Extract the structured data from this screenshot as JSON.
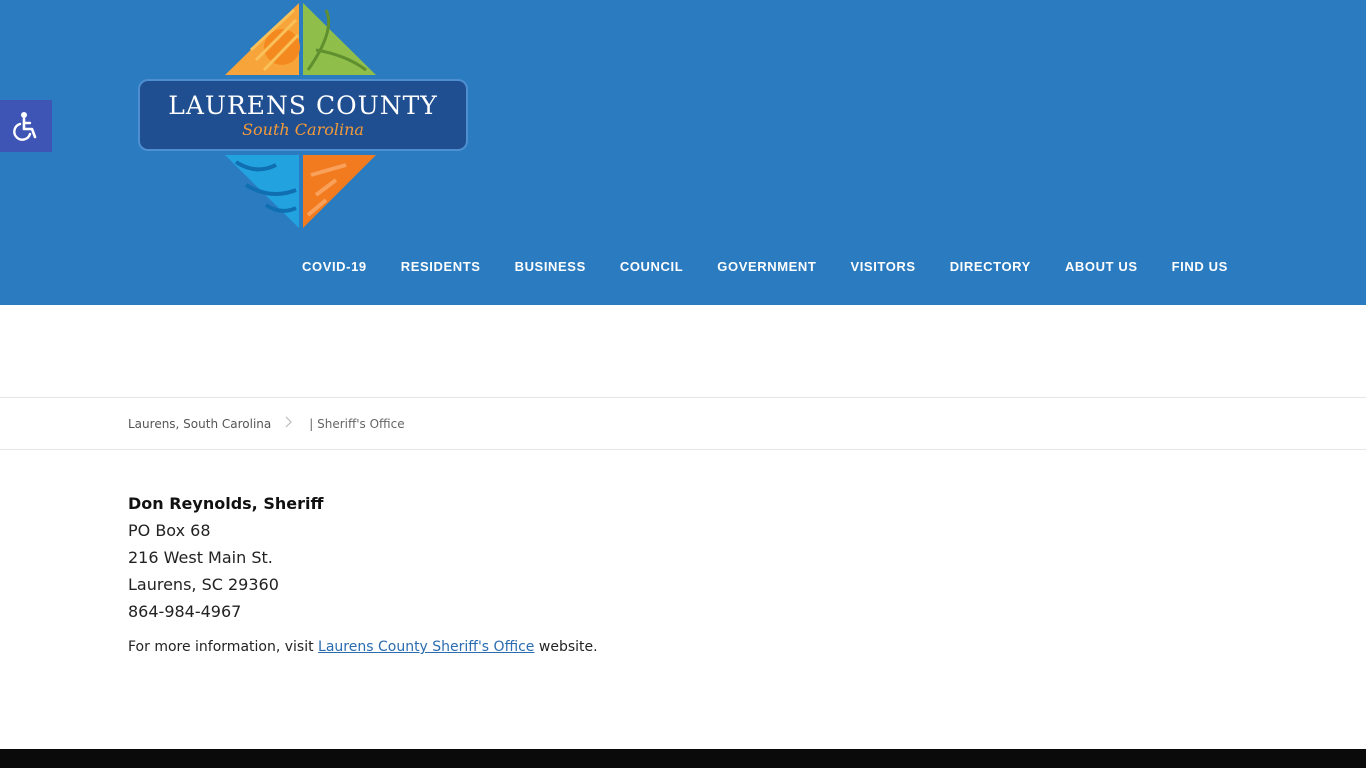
{
  "accessibility": {
    "icon": "wheelchair-icon"
  },
  "logo": {
    "title": "LAURENS COUNTY",
    "subtitle": "South Carolina"
  },
  "nav": {
    "items": [
      {
        "label": "COVID-19"
      },
      {
        "label": "RESIDENTS"
      },
      {
        "label": "BUSINESS"
      },
      {
        "label": "COUNCIL"
      },
      {
        "label": "GOVERNMENT"
      },
      {
        "label": "VISITORS"
      },
      {
        "label": "DIRECTORY"
      },
      {
        "label": "ABOUT US"
      },
      {
        "label": "FIND US"
      }
    ]
  },
  "breadcrumb": {
    "home": "Laurens, South Carolina",
    "separator_icon": "chevron-right-icon",
    "current": "| Sheriff's Office"
  },
  "contact": {
    "name": "Don Reynolds, Sheriff",
    "lines": [
      "PO Box 68",
      "216 West Main St.",
      "Laurens, SC 29360",
      "864-984-4967"
    ]
  },
  "more_info": {
    "prefix": "For more information, visit",
    "link": "Laurens County Sheriff's Office",
    "suffix": "website."
  },
  "colors": {
    "header_bg": "#2b7bc1",
    "accessibility_bg": "#3e55b5",
    "link": "#2b6cb0",
    "footer_bg": "#0a0a0a"
  }
}
